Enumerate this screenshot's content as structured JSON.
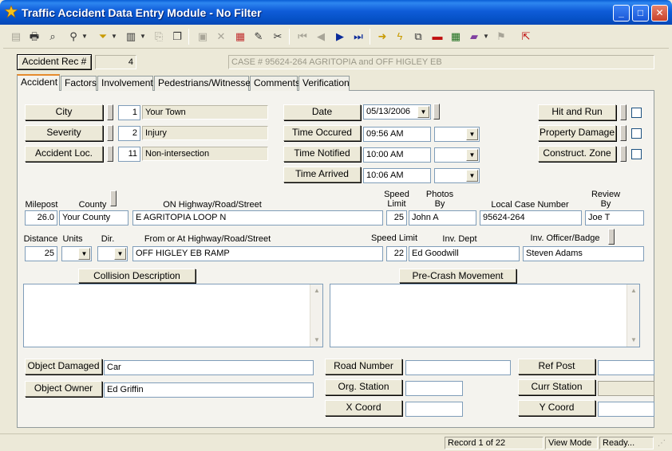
{
  "window": {
    "title": "Traffic Accident Data Entry Module - No Filter"
  },
  "record": {
    "button": "Accident Rec #",
    "number": "4",
    "case": "CASE # 95624-264  AGRITOPIA and OFF HIGLEY EB"
  },
  "tabs": [
    "Accident",
    "Factors",
    "Involvement",
    "Pedestrians/Witnesses",
    "Comments",
    "Verification"
  ],
  "lookups": {
    "city": {
      "label": "City",
      "code": "1",
      "value": "Your Town"
    },
    "severity": {
      "label": "Severity",
      "code": "2",
      "value": "Injury"
    },
    "location": {
      "label": "Accident Loc.",
      "code": "11",
      "value": "Non-intersection"
    }
  },
  "times": {
    "date_label": "Date",
    "date": "05/13/2006",
    "occured_label": "Time Occured",
    "occured": "09:56 AM",
    "notified_label": "Time Notified",
    "notified": "10:00 AM",
    "arrived_label": "Time Arrived",
    "arrived": "10:06 AM"
  },
  "flags": {
    "hit_run": "Hit and Run",
    "property": "Property Damage",
    "construct": "Construct. Zone"
  },
  "row1": {
    "milepost_label": "Milepost",
    "milepost": "26.0",
    "county_label": "County",
    "county": "Your County",
    "on_label": "ON Highway/Road/Street",
    "on": "E AGRITOPIA LOOP N",
    "speed_label": "Speed Limit",
    "speed": "25",
    "photos_label": "Photos By",
    "photos": "John A",
    "local_label": "Local Case Number",
    "local": "95624-264",
    "review_label": "Review By",
    "review": "Joe T"
  },
  "row2": {
    "distance_label": "Distance",
    "distance": "25",
    "units_label": "Units",
    "dir_label": "Dir.",
    "from_label": "From or At Highway/Road/Street",
    "from": "OFF HIGLEY EB RAMP",
    "speed_label": "Speed Limit",
    "speed": "22",
    "dept_label": "Inv. Dept",
    "dept": "Ed Goodwill",
    "officer_label": "Inv. Officer/Badge",
    "officer": "Steven Adams"
  },
  "desc": {
    "collision": "Collision Description",
    "precrash": "Pre-Crash Movement"
  },
  "bottom": {
    "object_damaged": "Object Damaged",
    "object_damaged_value": "Car",
    "object_owner": "Object Owner",
    "object_owner_value": "Ed Griffin",
    "road_number": "Road Number",
    "org_station": "Org. Station",
    "x_coord": "X Coord",
    "ref_post": "Ref Post",
    "curr_station": "Curr Station",
    "y_coord": "Y Coord"
  },
  "status": {
    "record": "Record 1 of 22",
    "mode": "View Mode",
    "state": "Ready..."
  }
}
